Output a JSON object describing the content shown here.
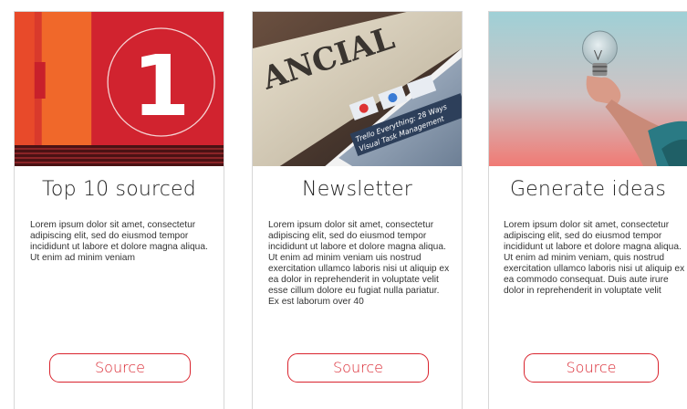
{
  "cards": [
    {
      "image_icon": "number-one-badge",
      "image_number": "1",
      "title": "Top 10 sourced",
      "body": "Lorem ipsum dolor sit amet, consectetur adipiscing elit, sed do eiusmod tempor incididunt ut labore et dolore magna aliqua. Ut enim ad minim veniam",
      "button_label": "Source"
    },
    {
      "image_icon": "newspaper-tablet",
      "image_text_1": "ANCIAL",
      "image_text_2": "Trello Everything: 28 Ways",
      "image_text_3": "Visual Task Management",
      "title": "Newsletter",
      "body": "Lorem ipsum dolor sit amet, consectetur adipiscing elit, sed do eiusmod tempor incididunt ut labore et dolore magna aliqua. Ut enim ad minim veniam uis nostrud exercitation ullamco laboris nisi ut aliquip ex ea dolor in reprehenderit in voluptate velit esse cillum dolore eu fugiat nulla pariatur. Ex est laborum over 40",
      "button_label": "Source"
    },
    {
      "image_icon": "hand-holding-lightbulb",
      "title": "Generate ideas",
      "body": "Lorem ipsum dolor sit amet, consectetur adipiscing elit, sed do eiusmod tempor incididunt ut labore et dolore magna aliqua. Ut enim ad minim veniam, quis nostrud exercitation ullamco laboris nisi ut aliquip ex ea commodo consequat. Duis aute irure dolor in reprehenderit in voluptate velit",
      "button_label": "Source"
    }
  ],
  "colors": {
    "accent": "#d9242e",
    "card_border": "#d7d7d7",
    "title": "#222222",
    "body": "#333333"
  }
}
